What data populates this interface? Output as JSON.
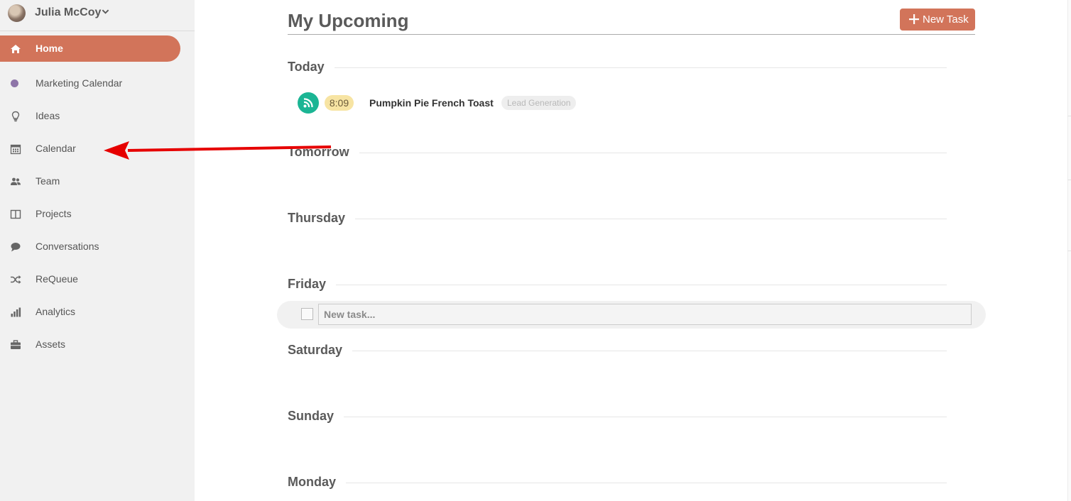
{
  "user": {
    "name": "Julia McCoy",
    "avatar_icon": "user-avatar"
  },
  "sidebar": {
    "items": [
      {
        "label": "Home",
        "icon": "home-icon",
        "active": true
      },
      {
        "label": "Marketing Calendar",
        "icon": "purple-dot-icon"
      },
      {
        "label": "Ideas",
        "icon": "lightbulb-icon"
      },
      {
        "label": "Calendar",
        "icon": "calendar-icon"
      },
      {
        "label": "Team",
        "icon": "team-icon"
      },
      {
        "label": "Projects",
        "icon": "columns-icon"
      },
      {
        "label": "Conversations",
        "icon": "speech-bubble-icon"
      },
      {
        "label": "ReQueue",
        "icon": "shuffle-icon"
      },
      {
        "label": "Analytics",
        "icon": "bar-chart-icon"
      },
      {
        "label": "Assets",
        "icon": "briefcase-icon"
      }
    ]
  },
  "main": {
    "title": "My Upcoming",
    "new_task_label": "New Task",
    "days": [
      "Today",
      "Tomorrow",
      "Thursday",
      "Friday",
      "Saturday",
      "Sunday",
      "Monday"
    ],
    "task": {
      "time": "8:09",
      "title": "Pumpkin Pie French Toast",
      "tag": "Lead Generation",
      "icon": "rss-icon"
    },
    "new_task_placeholder": "New task..."
  },
  "colors": {
    "accent": "#d2745a",
    "sidebar_bg": "#f1f1f1",
    "rss_green": "#1bb594",
    "time_badge": "#f7e4a3",
    "arrow_red": "#e60000"
  }
}
